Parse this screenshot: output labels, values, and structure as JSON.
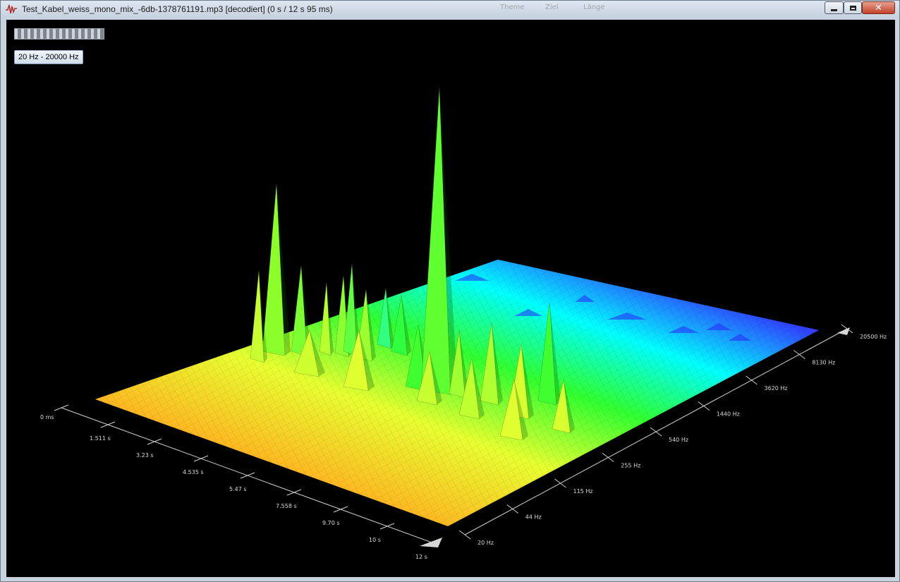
{
  "window": {
    "title": "Test_Kabel_weiss_mono_mix_-6db-1378761191.mp3 [decodiert] (0 s / 12 s 95 ms)",
    "icon": "waveform-icon",
    "background_menu": [
      "Theme",
      "Ziel",
      "Länge"
    ],
    "controls": {
      "minimize": "minimize-icon",
      "maximize": "maximize-icon",
      "close": "close-icon"
    }
  },
  "toolbar": {
    "frequency_range_label": "20 Hz - 20000 Hz",
    "position_slider": "scrub-slider"
  },
  "chart_data": {
    "type": "surface-3d",
    "title": "",
    "time_axis": {
      "label": "",
      "ticks": [
        "0 ms",
        "1.511 s",
        "3.23 s",
        "4.535 s",
        "5.47 s",
        "7.558 s",
        "9.70 s",
        "10 s",
        "12 s"
      ]
    },
    "frequency_axis": {
      "label": "",
      "scale": "log",
      "ticks": [
        "20 Hz",
        "44 Hz",
        "115 Hz",
        "255 Hz",
        "540 Hz",
        "1440 Hz",
        "3620 Hz",
        "8130 Hz",
        "20500 Hz"
      ]
    },
    "colormap": [
      "#ff1a1a",
      "#ff9a1a",
      "#e8ff30",
      "#30ff30",
      "#00ffff",
      "#2020ff",
      "#ff20ff"
    ]
  }
}
